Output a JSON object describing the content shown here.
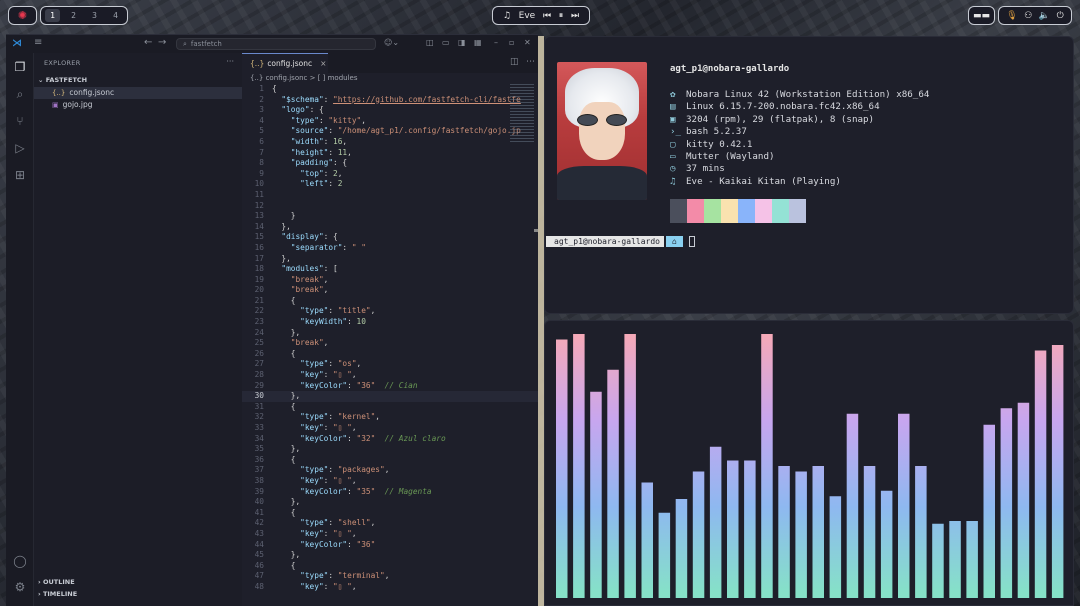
{
  "topbar": {
    "workspaces": [
      "1",
      "2",
      "3",
      "4"
    ],
    "active_workspace": "1",
    "media": {
      "icon": "♫",
      "title": "Eve",
      "prev": "⏮",
      "pause": "⏸",
      "next": "⏭"
    }
  },
  "vscode": {
    "search": "fastfetch",
    "explorer_label": "EXPLORER",
    "explorer_more": "···",
    "folder": "FASTFETCH",
    "files": [
      {
        "name": "config.jsonc",
        "icon": "{..}",
        "selected": true
      },
      {
        "name": "gojo.jpg",
        "icon": "▣",
        "selected": false
      }
    ],
    "outline": "OUTLINE",
    "timeline": "TIMELINE",
    "tab": {
      "name": "config.jsonc",
      "icon": "{..}",
      "close": "×"
    },
    "breadcrumb": "{..} config.jsonc > [ ] modules",
    "current_line": 30,
    "code": [
      [
        {
          "t": "{",
          "c": "p"
        }
      ],
      [
        {
          "t": "  \"$schema\"",
          "c": "k"
        },
        {
          "t": ": ",
          "c": "p"
        },
        {
          "t": "\"https://github.com/fastfetch-cli/fastfe",
          "c": "u"
        }
      ],
      [
        {
          "t": "  \"logo\"",
          "c": "k"
        },
        {
          "t": ": {",
          "c": "p"
        }
      ],
      [
        {
          "t": "    \"type\"",
          "c": "k"
        },
        {
          "t": ": ",
          "c": "p"
        },
        {
          "t": "\"kitty\"",
          "c": "s"
        },
        {
          "t": ",",
          "c": "p"
        }
      ],
      [
        {
          "t": "    \"source\"",
          "c": "k"
        },
        {
          "t": ": ",
          "c": "p"
        },
        {
          "t": "\"/home/agt_p1/.config/fastfetch/gojo.jp",
          "c": "s"
        }
      ],
      [
        {
          "t": "    \"width\"",
          "c": "k"
        },
        {
          "t": ": ",
          "c": "p"
        },
        {
          "t": "16",
          "c": "n"
        },
        {
          "t": ",",
          "c": "p"
        }
      ],
      [
        {
          "t": "    \"height\"",
          "c": "k"
        },
        {
          "t": ": ",
          "c": "p"
        },
        {
          "t": "11",
          "c": "n"
        },
        {
          "t": ",",
          "c": "p"
        }
      ],
      [
        {
          "t": "    \"padding\"",
          "c": "k"
        },
        {
          "t": ": {",
          "c": "p"
        }
      ],
      [
        {
          "t": "      \"top\"",
          "c": "k"
        },
        {
          "t": ": ",
          "c": "p"
        },
        {
          "t": "2",
          "c": "n"
        },
        {
          "t": ",",
          "c": "p"
        }
      ],
      [
        {
          "t": "      \"left\"",
          "c": "k"
        },
        {
          "t": ": ",
          "c": "p"
        },
        {
          "t": "2",
          "c": "n"
        }
      ],
      [],
      [],
      [
        {
          "t": "    }",
          "c": "p"
        }
      ],
      [
        {
          "t": "  },",
          "c": "p"
        }
      ],
      [
        {
          "t": "  \"display\"",
          "c": "k"
        },
        {
          "t": ": {",
          "c": "p"
        }
      ],
      [
        {
          "t": "    \"separator\"",
          "c": "k"
        },
        {
          "t": ": ",
          "c": "p"
        },
        {
          "t": "\" \"",
          "c": "s"
        }
      ],
      [
        {
          "t": "  },",
          "c": "p"
        }
      ],
      [
        {
          "t": "  \"modules\"",
          "c": "k"
        },
        {
          "t": ": [",
          "c": "p"
        }
      ],
      [
        {
          "t": "    \"break\"",
          "c": "s"
        },
        {
          "t": ",",
          "c": "p"
        }
      ],
      [
        {
          "t": "    \"break\"",
          "c": "s"
        },
        {
          "t": ",",
          "c": "p"
        }
      ],
      [
        {
          "t": "    {",
          "c": "p"
        }
      ],
      [
        {
          "t": "      \"type\"",
          "c": "k"
        },
        {
          "t": ": ",
          "c": "p"
        },
        {
          "t": "\"title\"",
          "c": "s"
        },
        {
          "t": ",",
          "c": "p"
        }
      ],
      [
        {
          "t": "      \"keyWidth\"",
          "c": "k"
        },
        {
          "t": ": ",
          "c": "p"
        },
        {
          "t": "10",
          "c": "n"
        }
      ],
      [
        {
          "t": "    },",
          "c": "p"
        }
      ],
      [
        {
          "t": "    \"break\"",
          "c": "s"
        },
        {
          "t": ",",
          "c": "p"
        }
      ],
      [
        {
          "t": "    {",
          "c": "p"
        }
      ],
      [
        {
          "t": "      \"type\"",
          "c": "k"
        },
        {
          "t": ": ",
          "c": "p"
        },
        {
          "t": "\"os\"",
          "c": "s"
        },
        {
          "t": ",",
          "c": "p"
        }
      ],
      [
        {
          "t": "      \"key\"",
          "c": "k"
        },
        {
          "t": ": ",
          "c": "p"
        },
        {
          "t": "\"▯ \"",
          "c": "s"
        },
        {
          "t": ",",
          "c": "p"
        }
      ],
      [
        {
          "t": "      \"keyColor\"",
          "c": "k"
        },
        {
          "t": ": ",
          "c": "p"
        },
        {
          "t": "\"36\"",
          "c": "s"
        },
        {
          "t": "  // Cian",
          "c": "c"
        }
      ],
      [
        {
          "t": "    },",
          "c": "p"
        }
      ],
      [
        {
          "t": "    {",
          "c": "p"
        }
      ],
      [
        {
          "t": "      \"type\"",
          "c": "k"
        },
        {
          "t": ": ",
          "c": "p"
        },
        {
          "t": "\"kernel\"",
          "c": "s"
        },
        {
          "t": ",",
          "c": "p"
        }
      ],
      [
        {
          "t": "      \"key\"",
          "c": "k"
        },
        {
          "t": ": ",
          "c": "p"
        },
        {
          "t": "\"▯ \"",
          "c": "s"
        },
        {
          "t": ",",
          "c": "p"
        }
      ],
      [
        {
          "t": "      \"keyColor\"",
          "c": "k"
        },
        {
          "t": ": ",
          "c": "p"
        },
        {
          "t": "\"32\"",
          "c": "s"
        },
        {
          "t": "  // Azul claro",
          "c": "c"
        }
      ],
      [
        {
          "t": "    },",
          "c": "p"
        }
      ],
      [
        {
          "t": "    {",
          "c": "p"
        }
      ],
      [
        {
          "t": "      \"type\"",
          "c": "k"
        },
        {
          "t": ": ",
          "c": "p"
        },
        {
          "t": "\"packages\"",
          "c": "s"
        },
        {
          "t": ",",
          "c": "p"
        }
      ],
      [
        {
          "t": "      \"key\"",
          "c": "k"
        },
        {
          "t": ": ",
          "c": "p"
        },
        {
          "t": "\"▯ \"",
          "c": "s"
        },
        {
          "t": ",",
          "c": "p"
        }
      ],
      [
        {
          "t": "      \"keyColor\"",
          "c": "k"
        },
        {
          "t": ": ",
          "c": "p"
        },
        {
          "t": "\"35\"",
          "c": "s"
        },
        {
          "t": "  // Magenta",
          "c": "c"
        }
      ],
      [
        {
          "t": "    },",
          "c": "p"
        }
      ],
      [
        {
          "t": "    {",
          "c": "p"
        }
      ],
      [
        {
          "t": "      \"type\"",
          "c": "k"
        },
        {
          "t": ": ",
          "c": "p"
        },
        {
          "t": "\"shell\"",
          "c": "s"
        },
        {
          "t": ",",
          "c": "p"
        }
      ],
      [
        {
          "t": "      \"key\"",
          "c": "k"
        },
        {
          "t": ": ",
          "c": "p"
        },
        {
          "t": "\"▯ \"",
          "c": "s"
        },
        {
          "t": ",",
          "c": "p"
        }
      ],
      [
        {
          "t": "      \"keyColor\"",
          "c": "k"
        },
        {
          "t": ": ",
          "c": "p"
        },
        {
          "t": "\"36\"",
          "c": "s"
        }
      ],
      [
        {
          "t": "    },",
          "c": "p"
        }
      ],
      [
        {
          "t": "    {",
          "c": "p"
        }
      ],
      [
        {
          "t": "      \"type\"",
          "c": "k"
        },
        {
          "t": ": ",
          "c": "p"
        },
        {
          "t": "\"terminal\"",
          "c": "s"
        },
        {
          "t": ",",
          "c": "p"
        }
      ],
      [
        {
          "t": "      \"key\"",
          "c": "k"
        },
        {
          "t": ": ",
          "c": "p"
        },
        {
          "t": "\"▯ \"",
          "c": "s"
        },
        {
          "t": ",",
          "c": "p"
        }
      ]
    ]
  },
  "terminal": {
    "user_host": "agt_p1@nobara-gallardo",
    "info": [
      {
        "icon": "✿",
        "text": "Nobara Linux 42 (Workstation Edition) x86_64"
      },
      {
        "icon": "▤",
        "text": "Linux 6.15.7-200.nobara.fc42.x86_64"
      },
      {
        "icon": "▣",
        "text": "3204 (rpm), 29 (flatpak), 8 (snap)"
      },
      {
        "icon": "›_",
        "text": "bash 5.2.37"
      },
      {
        "icon": "▢",
        "text": "kitty 0.42.1"
      },
      {
        "icon": "▭",
        "text": "Mutter (Wayland)"
      },
      {
        "icon": "◷",
        "text": "37 mins"
      },
      {
        "icon": "♫",
        "text": "Eve - Kaikai Kitan (Playing)"
      }
    ],
    "palette": [
      "#4b4f5c",
      "#f38ba8",
      "#a6e3a1",
      "#f9e2af",
      "#89b4fa",
      "#f5c2e7",
      "#94e2d5",
      "#bac2de"
    ],
    "prompt_user": "agt_p1@nobara-gallardo",
    "prompt_dir": "⌂"
  },
  "visualizer": {
    "levels": [
      0.94,
      0.96,
      0.75,
      0.83,
      0.96,
      0.42,
      0.31,
      0.36,
      0.46,
      0.55,
      0.5,
      0.5,
      0.96,
      0.48,
      0.46,
      0.48,
      0.37,
      0.67,
      0.48,
      0.39,
      0.67,
      0.48,
      0.27,
      0.28,
      0.28,
      0.63,
      0.69,
      0.71,
      0.9,
      0.92
    ],
    "colors": [
      "#f5a9b8",
      "#c7a6ef",
      "#8eb8f0",
      "#86e1c8"
    ]
  }
}
